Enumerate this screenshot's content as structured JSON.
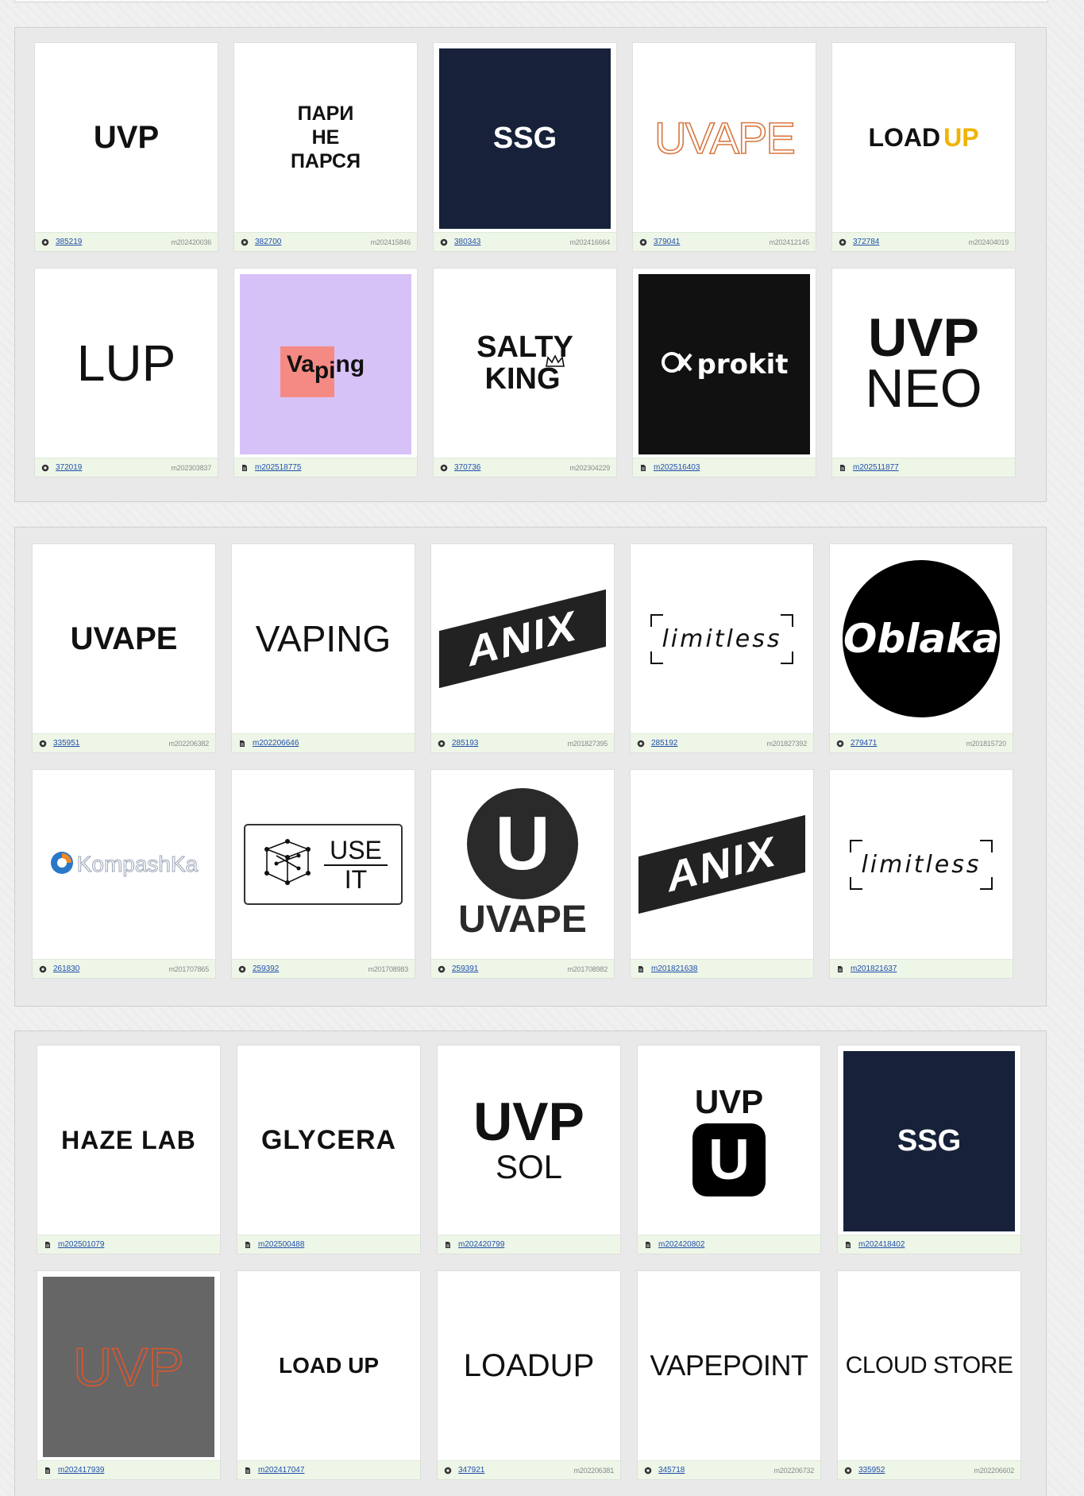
{
  "colors": {
    "link": "#1f4fa8",
    "footer_bg": "#eef6e8",
    "navy": "#17213a",
    "uvape_orange": "#d9773f",
    "loadup_yellow": "#f0b400",
    "vaping_lilac": "#d7c2f7",
    "vaping_pink": "#f58a84"
  },
  "groups": [
    {
      "cards": [
        {
          "logo_text": "UVP",
          "footer": {
            "icon": "eye-icon",
            "id": "385219",
            "code": "m202420036"
          }
        },
        {
          "logo_lines": [
            "ПАРИ",
            "НЕ",
            "ПАРСЯ"
          ],
          "footer": {
            "icon": "eye-icon",
            "id": "382700",
            "code": "m202415846"
          }
        },
        {
          "logo_text": "SSG",
          "footer": {
            "icon": "eye-icon",
            "id": "380343",
            "code": "m202416664"
          }
        },
        {
          "logo_text": "UVAPE",
          "footer": {
            "icon": "eye-icon",
            "id": "379041",
            "code": "m202412145"
          }
        },
        {
          "logo_text": "LOAD",
          "logo_text2": "UP",
          "footer": {
            "icon": "eye-icon",
            "id": "372784",
            "code": "m202404019"
          }
        },
        {
          "logo_text": "LUP",
          "footer": {
            "icon": "eye-icon",
            "id": "372019",
            "code": "m202303837"
          }
        },
        {
          "logo_text": "Va",
          "logo_text2": "pi",
          "logo_text3": "ng",
          "footer": {
            "icon": "document-icon",
            "id": "m202518775",
            "code": ""
          }
        },
        {
          "logo_lines": [
            "SALTY",
            "KING"
          ],
          "footer": {
            "icon": "eye-icon",
            "id": "370736",
            "code": "m202304229"
          }
        },
        {
          "logo_text": "prokit",
          "footer": {
            "icon": "document-icon",
            "id": "m202516403",
            "code": ""
          }
        },
        {
          "logo_lines": [
            "UVP",
            "NEO"
          ],
          "footer": {
            "icon": "document-icon",
            "id": "m202511877",
            "code": ""
          }
        }
      ]
    },
    {
      "cards": [
        {
          "logo_text": "UVAPE",
          "footer": {
            "icon": "eye-icon",
            "id": "335951",
            "code": "m202206382"
          }
        },
        {
          "logo_text": "VAPING",
          "footer": {
            "icon": "document-icon",
            "id": "m202206646",
            "code": ""
          }
        },
        {
          "logo_text": "ANIX",
          "footer": {
            "icon": "eye-icon",
            "id": "285193",
            "code": "m201827395"
          }
        },
        {
          "logo_text": "limitless",
          "footer": {
            "icon": "eye-icon",
            "id": "285192",
            "code": "m201827392"
          }
        },
        {
          "logo_text": "Oblaka",
          "footer": {
            "icon": "eye-icon",
            "id": "279471",
            "code": "m201815720"
          }
        },
        {
          "logo_text": "KompashKa",
          "footer": {
            "icon": "eye-icon",
            "id": "261830",
            "code": "m201707865"
          }
        },
        {
          "logo_lines": [
            "USE",
            "IT"
          ],
          "footer": {
            "icon": "eye-icon",
            "id": "259392",
            "code": "m201708983"
          }
        },
        {
          "logo_text": "U",
          "logo_text2": "UVAPE",
          "footer": {
            "icon": "eye-icon",
            "id": "259391",
            "code": "m201708982"
          }
        },
        {
          "logo_text": "ANIX",
          "footer": {
            "icon": "document-icon",
            "id": "m201821638",
            "code": ""
          }
        },
        {
          "logo_text": "limitless",
          "footer": {
            "icon": "document-icon",
            "id": "m201821637",
            "code": ""
          }
        }
      ]
    },
    {
      "cards": [
        {
          "logo_text": "HAZE LAB",
          "footer": {
            "icon": "document-icon",
            "id": "m202501079",
            "code": ""
          }
        },
        {
          "logo_text": "GLYCERA",
          "footer": {
            "icon": "document-icon",
            "id": "m202500488",
            "code": ""
          }
        },
        {
          "logo_lines": [
            "UVP",
            "SOL"
          ],
          "footer": {
            "icon": "document-icon",
            "id": "m202420799",
            "code": ""
          }
        },
        {
          "logo_text": "UVP",
          "logo_text2": "U",
          "footer": {
            "icon": "document-icon",
            "id": "m202420802",
            "code": ""
          }
        },
        {
          "logo_text": "SSG",
          "footer": {
            "icon": "document-icon",
            "id": "m202418402",
            "code": ""
          }
        },
        {
          "logo_text": "UVP",
          "footer": {
            "icon": "document-icon",
            "id": "m202417939",
            "code": ""
          }
        },
        {
          "logo_text": "LOAD UP",
          "footer": {
            "icon": "document-icon",
            "id": "m202417047",
            "code": ""
          }
        },
        {
          "logo_text": "LOADUP",
          "footer": {
            "icon": "eye-icon",
            "id": "347921",
            "code": "m202206381"
          }
        },
        {
          "logo_text": "VAPEPOINT",
          "footer": {
            "icon": "eye-icon",
            "id": "345718",
            "code": "m202206732"
          }
        },
        {
          "logo_text": "CLOUD STORE",
          "footer": {
            "icon": "eye-icon",
            "id": "335952",
            "code": "m202206602"
          }
        }
      ]
    }
  ]
}
